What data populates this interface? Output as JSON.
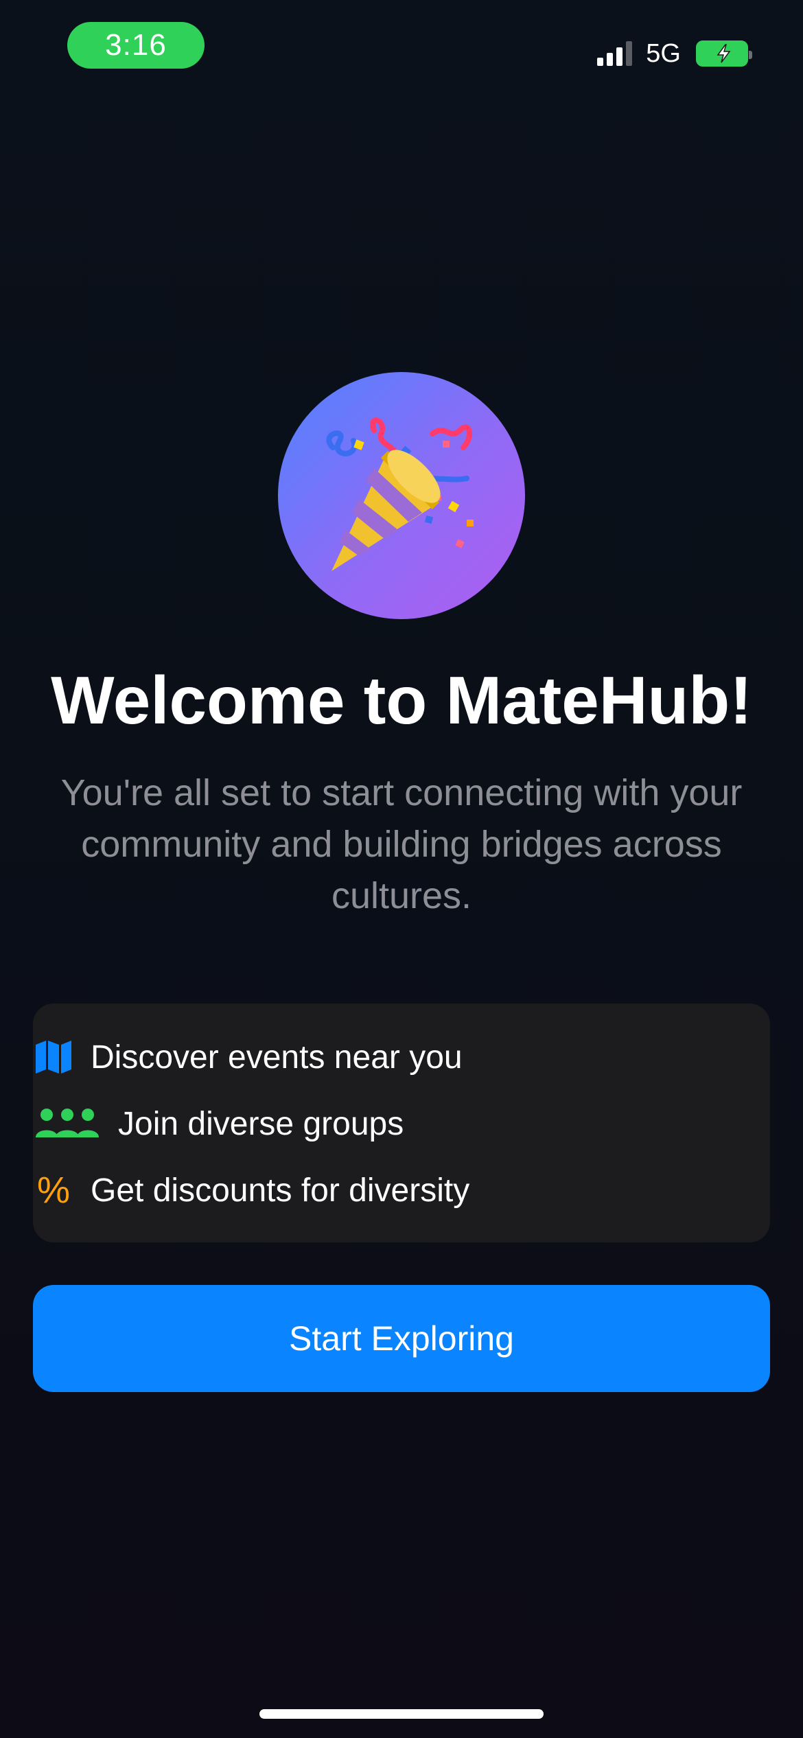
{
  "status_bar": {
    "time": "3:16",
    "network": "5G",
    "colors": {
      "time_pill": "#30d158",
      "battery": "#30d158"
    },
    "icons": [
      "signal-bars-icon",
      "battery-charging-icon"
    ]
  },
  "hero": {
    "icon": "party-popper-icon",
    "title": "Welcome to MateHub!",
    "subtitle": "You're all set to start connecting with your community and building bridges across cultures."
  },
  "features": [
    {
      "icon": "map-icon",
      "label": "Discover events near you",
      "color": "#0a84ff"
    },
    {
      "icon": "people-group-icon",
      "label": "Join diverse groups",
      "color": "#30d158"
    },
    {
      "icon": "percent-icon",
      "label": "Get discounts for diversity",
      "color": "#ff9f0a"
    }
  ],
  "percent_symbol": "%",
  "cta": {
    "label": "Start Exploring",
    "color": "#0a84ff"
  }
}
